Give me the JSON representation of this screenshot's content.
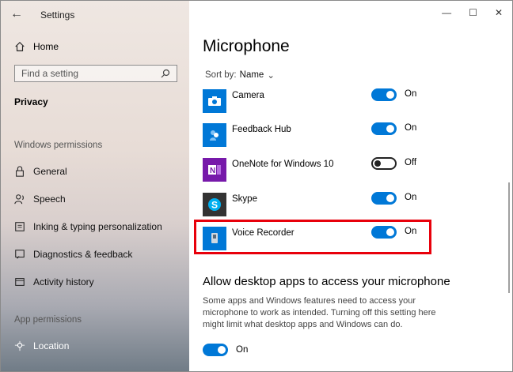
{
  "window": {
    "title": "Settings"
  },
  "sidebar": {
    "home_label": "Home",
    "search_placeholder": "Find a setting",
    "current": "Privacy",
    "sections": [
      {
        "title": "Windows permissions",
        "items": [
          "General",
          "Speech",
          "Inking & typing personalization",
          "Diagnostics & feedback",
          "Activity history"
        ]
      },
      {
        "title": "App permissions",
        "items": [
          "Location"
        ]
      }
    ]
  },
  "main": {
    "page_title": "Microphone",
    "sort": {
      "label": "Sort by:",
      "value": "Name"
    },
    "apps": [
      {
        "name": "Camera",
        "state": "On",
        "on": true,
        "icon": "camera-icon",
        "color": "#0078d7"
      },
      {
        "name": "Feedback Hub",
        "state": "On",
        "on": true,
        "icon": "feedback-hub-icon",
        "color": "#0078d7"
      },
      {
        "name": "OneNote for Windows 10",
        "state": "Off",
        "on": false,
        "icon": "onenote-icon",
        "color": "#7719aa"
      },
      {
        "name": "Skype",
        "state": "On",
        "on": true,
        "icon": "skype-icon",
        "color": "#00aff0"
      },
      {
        "name": "Voice Recorder",
        "state": "On",
        "on": true,
        "icon": "voice-recorder-icon",
        "color": "#0078d7"
      }
    ],
    "desktop_section": {
      "heading": "Allow desktop apps to access your microphone",
      "description": "Some apps and Windows features need to access your microphone to work as intended. Turning off this setting here might limit what desktop apps and Windows can do.",
      "state": "On"
    }
  },
  "colors": {
    "accent": "#0078d7",
    "highlight": "#e8000b"
  }
}
